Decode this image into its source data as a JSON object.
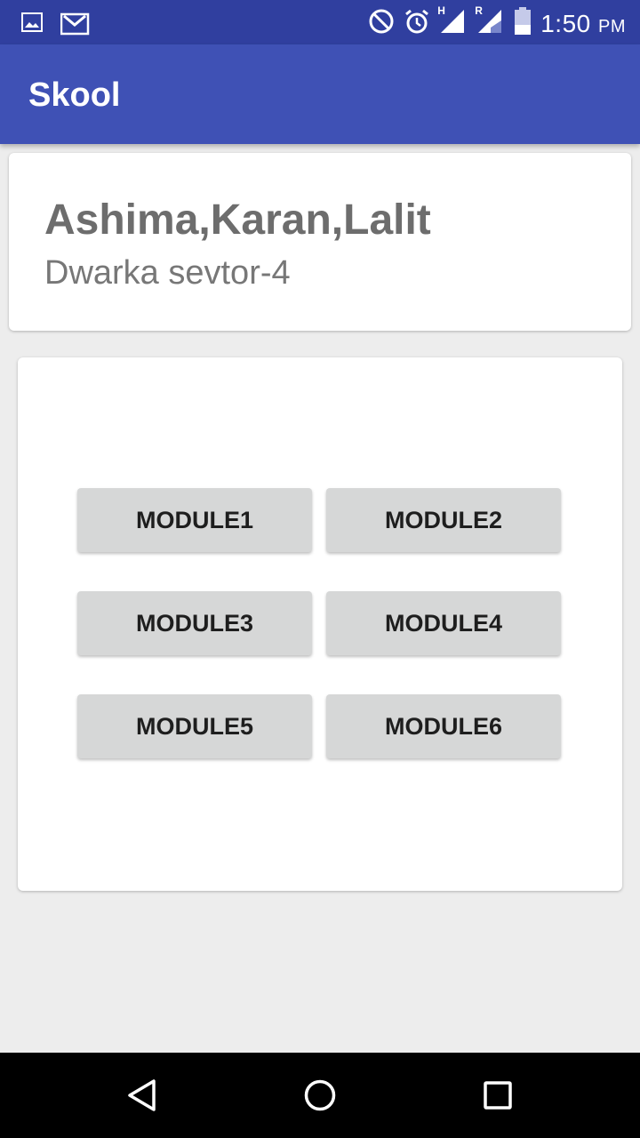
{
  "status_bar": {
    "time": "1:50",
    "ampm": "PM",
    "icons": [
      "gallery-icon",
      "gmail-icon",
      "do-not-disturb-icon",
      "alarm-icon",
      "signal-h-icon",
      "signal-r-icon",
      "battery-icon"
    ],
    "signal_h_label": "H",
    "signal_r_label": "R"
  },
  "app_bar": {
    "title": "Skool"
  },
  "info_card": {
    "name": "Ashima,Karan,Lalit",
    "address": "Dwarka sevtor-4"
  },
  "modules": [
    {
      "label": "MODULE1"
    },
    {
      "label": "MODULE2"
    },
    {
      "label": "MODULE3"
    },
    {
      "label": "MODULE4"
    },
    {
      "label": "MODULE5"
    },
    {
      "label": "MODULE6"
    }
  ],
  "nav_bar": {
    "icons": [
      "back-icon",
      "home-icon",
      "recents-icon"
    ]
  },
  "colors": {
    "primary": "#3f51b5",
    "primary_dark": "#303f9f",
    "background": "#ededed",
    "button": "#d6d7d7"
  }
}
